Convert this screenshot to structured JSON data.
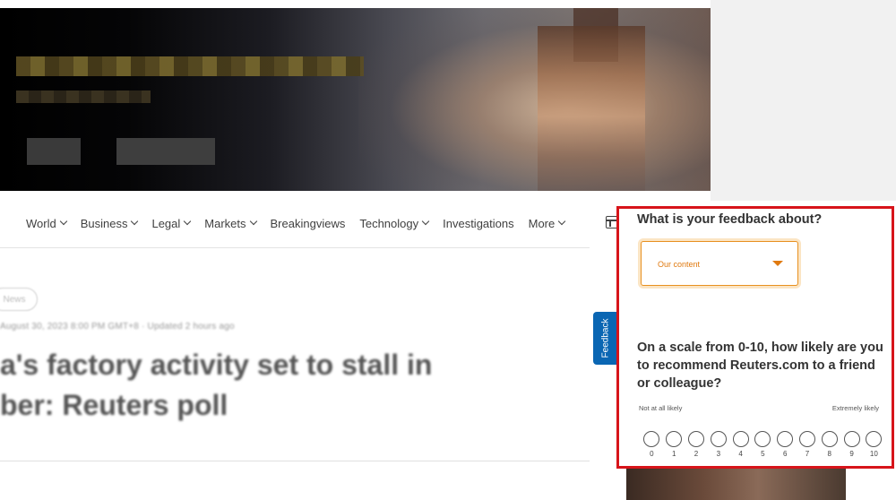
{
  "banner": {
    "title_blurred": "",
    "subtitle_blurred": ""
  },
  "nav": {
    "items": [
      {
        "label": "World",
        "has_dropdown": true
      },
      {
        "label": "Business",
        "has_dropdown": true
      },
      {
        "label": "Legal",
        "has_dropdown": true
      },
      {
        "label": "Markets",
        "has_dropdown": true
      },
      {
        "label": "Breakingviews",
        "has_dropdown": false
      },
      {
        "label": "Technology",
        "has_dropdown": true
      },
      {
        "label": "Investigations",
        "has_dropdown": false
      },
      {
        "label": "More",
        "has_dropdown": true
      }
    ],
    "layout_icon": "grid-icon"
  },
  "article": {
    "tag": "News",
    "byline": "August 30, 2023 8:00 PM GMT+8 · Updated 2 hours ago",
    "headline_line1": "a's factory activity set to stall in",
    "headline_line2": "ber: Reuters poll"
  },
  "feedback_tab": {
    "label": "Feedback"
  },
  "feedback_panel": {
    "question1": "What is your feedback about?",
    "select_value": "Our content",
    "question2": "On a scale from 0-10, how likely are you to recommend Reuters.com to a friend or colleague?",
    "scale_low_label": "Not at all likely",
    "scale_high_label": "Extremely likely",
    "scale_options": [
      "0",
      "1",
      "2",
      "3",
      "4",
      "5",
      "6",
      "7",
      "8",
      "9",
      "10"
    ],
    "highlight_color": "#d7141a",
    "select_accent_color": "#e07a10"
  }
}
